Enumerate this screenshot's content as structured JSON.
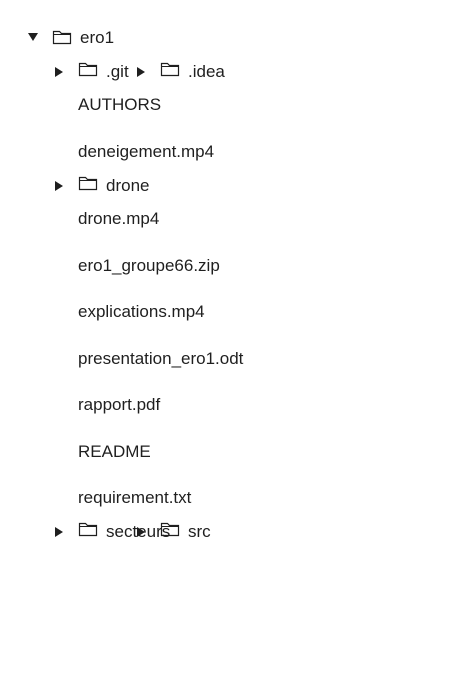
{
  "tree": {
    "root": {
      "label": "ero1",
      "expanded": true
    },
    "items": [
      {
        "type": "folder",
        "label": ".git"
      },
      {
        "type": "folder",
        "label": ".idea"
      },
      {
        "type": "file",
        "label": "AUTHORS"
      },
      {
        "type": "file",
        "label": "deneigement.mp4"
      },
      {
        "type": "folder",
        "label": "drone"
      },
      {
        "type": "file",
        "label": "drone.mp4"
      },
      {
        "type": "file",
        "label": "ero1_groupe66.zip"
      },
      {
        "type": "file",
        "label": "explications.mp4"
      },
      {
        "type": "file",
        "label": "presentation_ero1.odt"
      },
      {
        "type": "file",
        "label": "rapport.pdf"
      },
      {
        "type": "file",
        "label": "README"
      },
      {
        "type": "file",
        "label": "requirement.txt"
      },
      {
        "type": "folder",
        "label": "secteurs"
      },
      {
        "type": "folder",
        "label": "src"
      }
    ]
  },
  "icons": {
    "expanded": "triangle-down-icon",
    "collapsed": "triangle-right-icon",
    "folder": "folder-icon"
  },
  "colors": {
    "text": "#1f1f1f",
    "icon": "#1f1f1f"
  }
}
